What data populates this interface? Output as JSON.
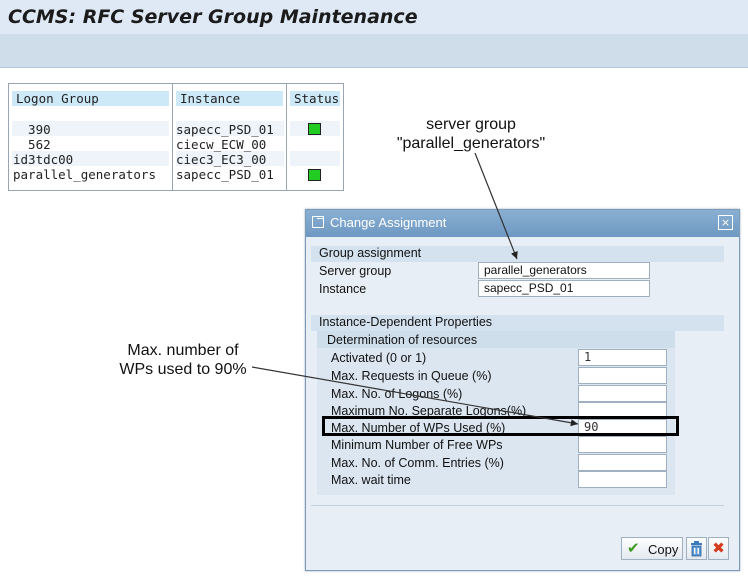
{
  "app": {
    "title": "CCMS: RFC Server Group Maintenance"
  },
  "table": {
    "columns": [
      "Logon Group",
      "Instance",
      "Status"
    ],
    "rows": [
      {
        "group": "  390",
        "instance": "sapecc_PSD_01",
        "status": "green"
      },
      {
        "group": "  562",
        "instance": "ciecw_ECW_00",
        "status": "none"
      },
      {
        "group": "id3tdc00",
        "instance": "ciec3_EC3_00",
        "status": "none"
      },
      {
        "group": "parallel_generators",
        "instance": "sapecc_PSD_01",
        "status": "green"
      }
    ]
  },
  "annotations": {
    "server_group_line1": "server group",
    "server_group_line2": "\"parallel_generators\"",
    "max_wps_line1": "Max. number of",
    "max_wps_line2": "WPs used to 90%"
  },
  "dialog": {
    "title": "Change Assignment",
    "close_glyph": "×",
    "group_assignment": {
      "title": "Group assignment",
      "server_group_label": "Server group",
      "server_group_value": "parallel_generators",
      "instance_label": "Instance",
      "instance_value": "sapecc_PSD_01"
    },
    "instance_props": {
      "title": "Instance-Dependent Properties",
      "sub_title": "Determination of resources",
      "fields": [
        {
          "label": "Activated (0 or 1)",
          "value": "1"
        },
        {
          "label": "Max. Requests in Queue (%)",
          "value": ""
        },
        {
          "label": "Max. No. of Logons (%)",
          "value": ""
        },
        {
          "label": "Maximum No. Separate Logons(%)",
          "value": ""
        },
        {
          "label": "Max. Number of WPs Used (%)",
          "value": "90"
        },
        {
          "label": "Minimum Number of Free WPs",
          "value": ""
        },
        {
          "label": "Max. No. of Comm. Entries (%)",
          "value": ""
        },
        {
          "label": "Max. wait time",
          "value": ""
        }
      ]
    },
    "buttons": {
      "copy": "Copy"
    }
  },
  "colors": {
    "status_green": "#22cc22",
    "accent": "#6f98c2"
  },
  "icons": {
    "copy": "check-icon",
    "delete": "trash-icon",
    "cancel": "x-icon"
  }
}
